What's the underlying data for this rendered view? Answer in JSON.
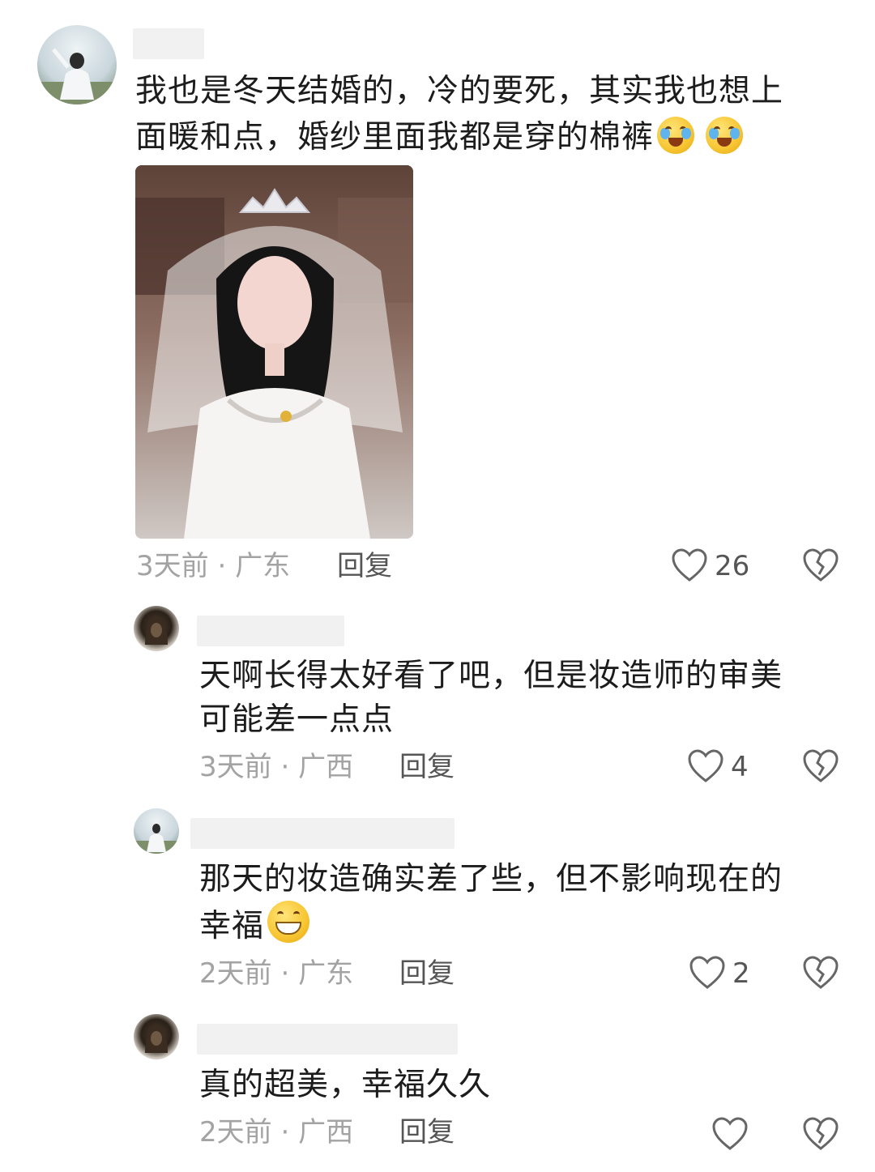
{
  "comments": [
    {
      "text_lines": [
        "我也是冬天结婚的，冷的要死，其实我也想上",
        "面暖和点，婚纱里面我都是穿的棉裤"
      ],
      "emojis": [
        "crying-laughing-emoji",
        "crying-laughing-emoji"
      ],
      "time": "3天前",
      "location": "广东",
      "reply_label": "回复",
      "likes": "26"
    },
    {
      "text_lines": [
        "天啊长得太好看了吧，但是妆造师的审美",
        "可能差一点点"
      ],
      "time": "3天前",
      "location": "广西",
      "reply_label": "回复",
      "likes": "4"
    },
    {
      "text_lines": [
        "那天的妆造确实差了些，但不影响现在的",
        "幸福"
      ],
      "emojis": [
        "grinning-emoji"
      ],
      "time": "2天前",
      "location": "广东",
      "reply_label": "回复",
      "likes": "2"
    },
    {
      "text_lines": [
        "真的超美，幸福久久"
      ],
      "time": "2天前",
      "location": "广西",
      "reply_label": "回复",
      "likes": ""
    }
  ],
  "meta_separator": " · ",
  "icons": {
    "like": "heart-outline-icon",
    "dislike": "broken-heart-icon"
  },
  "colors": {
    "meta_gray": "#a3a3a3",
    "text": "#1c1c1c"
  }
}
